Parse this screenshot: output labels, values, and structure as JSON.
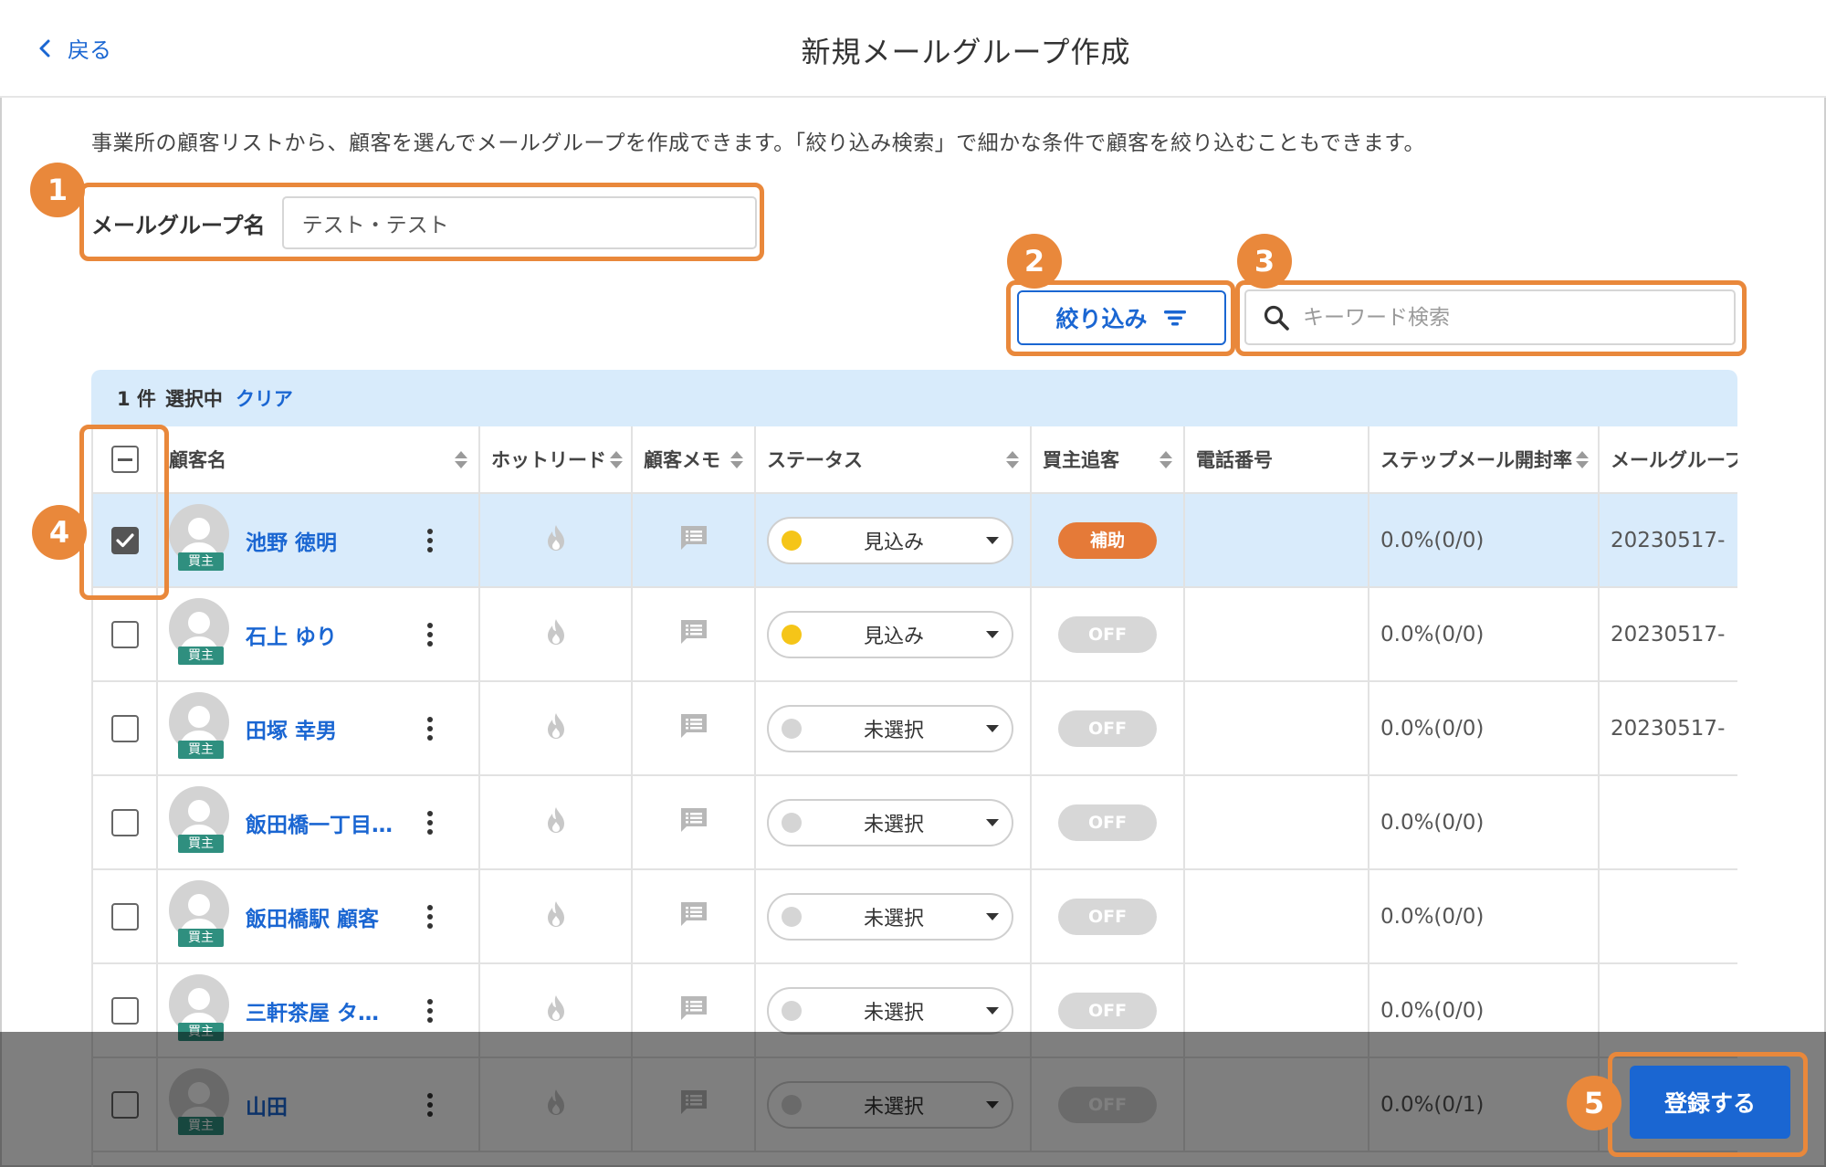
{
  "header": {
    "back_label": "戻る",
    "title": "新規メールグループ作成"
  },
  "description": "事業所の顧客リストから、顧客を選んでメールグループを作成できます。「絞り込み検索」で細かな条件で顧客を絞り込むこともできます。",
  "group_name": {
    "label": "メールグループ名",
    "value": "テスト・テスト"
  },
  "toolbar": {
    "filter_label": "絞り込み",
    "search_placeholder": "キーワード検索"
  },
  "selection": {
    "count_text": "1 件",
    "selected_text": "選択中",
    "clear_label": "クリア"
  },
  "table": {
    "columns": {
      "name": "顧客名",
      "hot_lead": "ホットリード",
      "memo": "顧客メモ",
      "status": "ステータス",
      "buyer_follow": "買主追客",
      "phone": "電話番号",
      "step_mail": "ステップメール開封率",
      "mail_group": "メールグループ"
    },
    "rows": [
      {
        "name": "池野 徳明",
        "badge": "買主",
        "status": "見込み",
        "status_color": "#f5c518",
        "buyer": "補助",
        "buyer_on": true,
        "phone": "",
        "step": "0.0%(0/0)",
        "group": "20230517-",
        "checked": true
      },
      {
        "name": "石上 ゆり",
        "badge": "買主",
        "status": "見込み",
        "status_color": "#f5c518",
        "buyer": "OFF",
        "buyer_on": false,
        "phone": "",
        "step": "0.0%(0/0)",
        "group": "20230517-",
        "checked": false
      },
      {
        "name": "田塚 幸男",
        "badge": "買主",
        "status": "未選択",
        "status_color": "#d5d5d5",
        "buyer": "OFF",
        "buyer_on": false,
        "phone": "",
        "step": "0.0%(0/0)",
        "group": "20230517-",
        "checked": false
      },
      {
        "name": "飯田橋一丁目…",
        "badge": "買主",
        "status": "未選択",
        "status_color": "#d5d5d5",
        "buyer": "OFF",
        "buyer_on": false,
        "phone": "",
        "step": "0.0%(0/0)",
        "group": "",
        "checked": false
      },
      {
        "name": "飯田橋駅 顧客",
        "badge": "買主",
        "status": "未選択",
        "status_color": "#d5d5d5",
        "buyer": "OFF",
        "buyer_on": false,
        "phone": "",
        "step": "0.0%(0/0)",
        "group": "",
        "checked": false
      },
      {
        "name": "三軒茶屋 タ…",
        "badge": "買主",
        "status": "未選択",
        "status_color": "#d5d5d5",
        "buyer": "OFF",
        "buyer_on": false,
        "phone": "",
        "step": "0.0%(0/0)",
        "group": "",
        "checked": false
      },
      {
        "name": "山田",
        "badge": "買主",
        "status": "未選択",
        "status_color": "#d5d5d5",
        "buyer": "OFF",
        "buyer_on": false,
        "phone": "",
        "step": "0.0%(0/1)",
        "group": "",
        "checked": false
      }
    ]
  },
  "submit_label": "登録する",
  "annotations": [
    "1",
    "2",
    "3",
    "4",
    "5"
  ],
  "colors": {
    "accent": "#1a66d2",
    "annotation": "#e9883b",
    "selected_row": "#d9ebfb",
    "badge": "#2f8f7f"
  }
}
